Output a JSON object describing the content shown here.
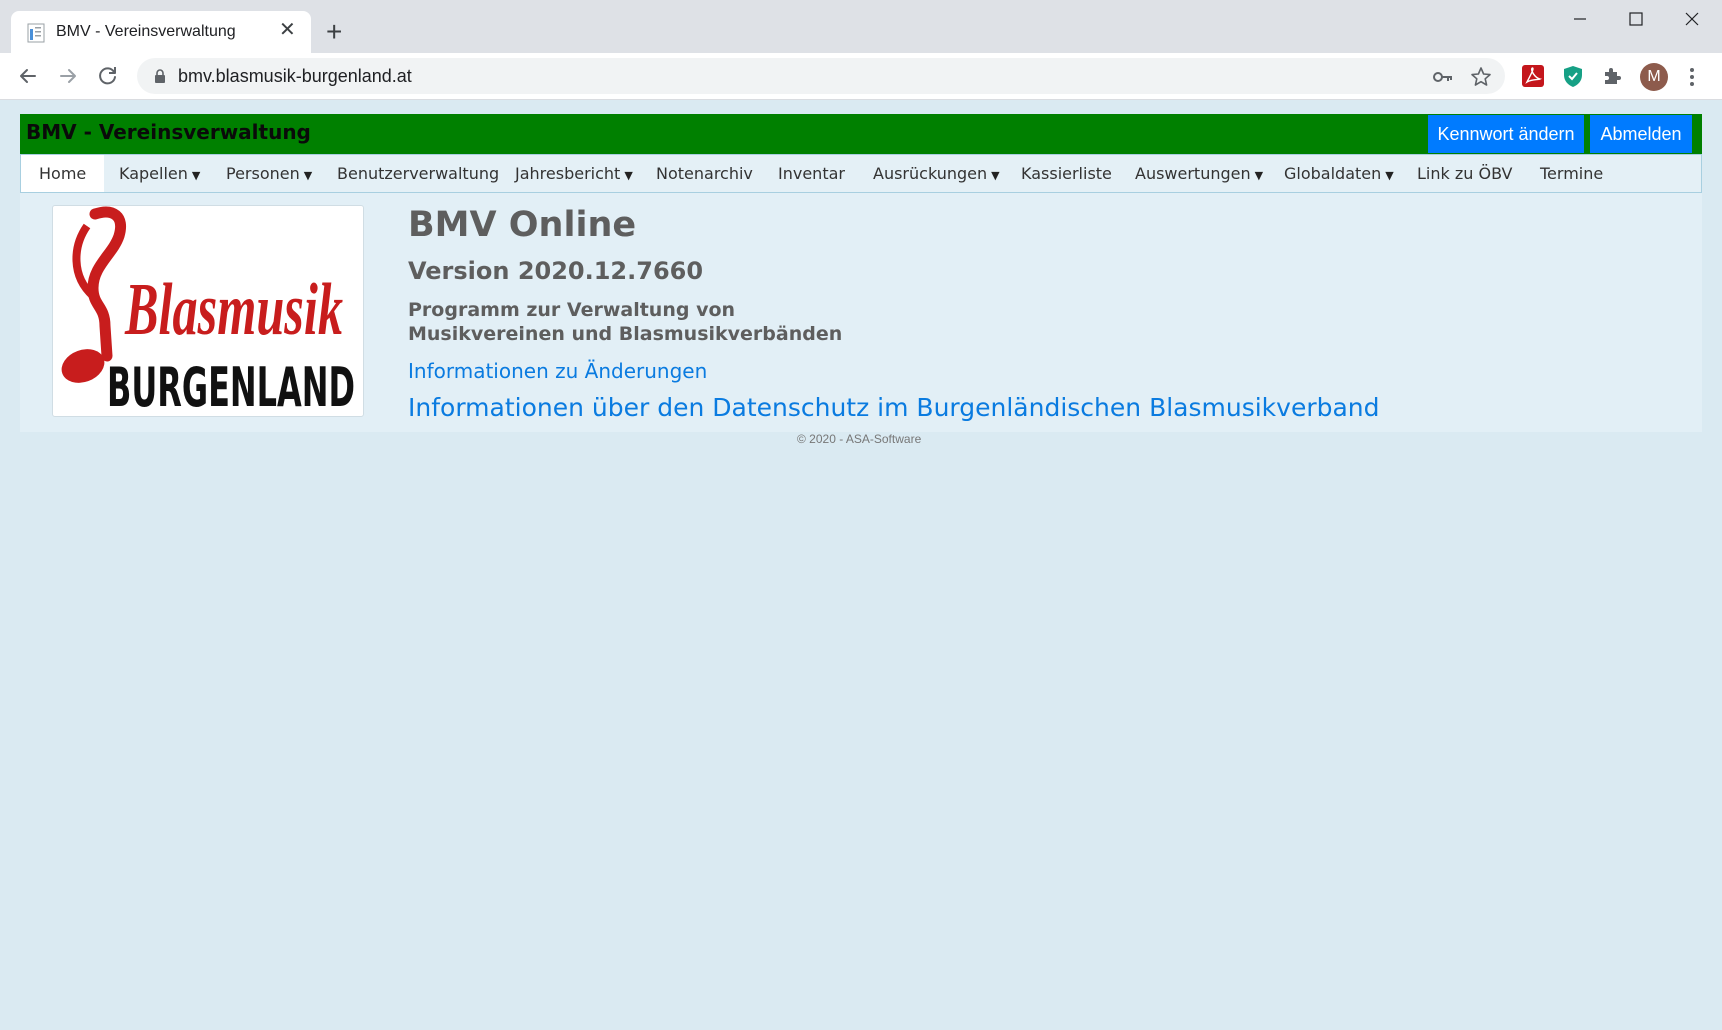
{
  "browser": {
    "tab_title": "BMV - Vereinsverwaltung",
    "tab_close": "✕",
    "new_tab": "+",
    "url": "bmv.blasmusik-burgenland.at",
    "avatar_letter": "M"
  },
  "app": {
    "title": "BMV - Vereinsverwaltung",
    "change_password_label": "Kennwort ändern",
    "logout_label": "Abmelden",
    "header_color": "#008000",
    "button_color": "#007bff"
  },
  "nav": {
    "items": [
      {
        "label": "Home",
        "dropdown": false,
        "active": true
      },
      {
        "label": "Kapellen",
        "dropdown": true
      },
      {
        "label": "Personen",
        "dropdown": true
      },
      {
        "label": "Benutzerverwaltung",
        "dropdown": false
      },
      {
        "label": "Jahresbericht",
        "dropdown": true
      },
      {
        "label": "Notenarchiv",
        "dropdown": false
      },
      {
        "label": "Inventar",
        "dropdown": false
      },
      {
        "label": "Ausrückungen",
        "dropdown": true
      },
      {
        "label": "Kassierliste",
        "dropdown": false
      },
      {
        "label": "Auswertungen",
        "dropdown": true
      },
      {
        "label": "Globaldaten",
        "dropdown": true
      },
      {
        "label": "Link zu ÖBV",
        "dropdown": false
      },
      {
        "label": "Termine",
        "dropdown": false
      }
    ],
    "caret": "▼"
  },
  "main": {
    "logo_text_top": "Blasmusik",
    "logo_text_bottom": "BURGENLAND",
    "heading": "BMV Online",
    "version": "Version 2020.12.7660",
    "description_line1": "Programm zur Verwaltung von",
    "description_line2": "Musikvereinen und Blasmusikverbänden",
    "link_changes": "Informationen zu Änderungen",
    "link_privacy": "Informationen über den Datenschutz im Burgenländischen Blasmusikverband"
  },
  "footer": {
    "copyright": "© 2020 - ASA-Software"
  }
}
